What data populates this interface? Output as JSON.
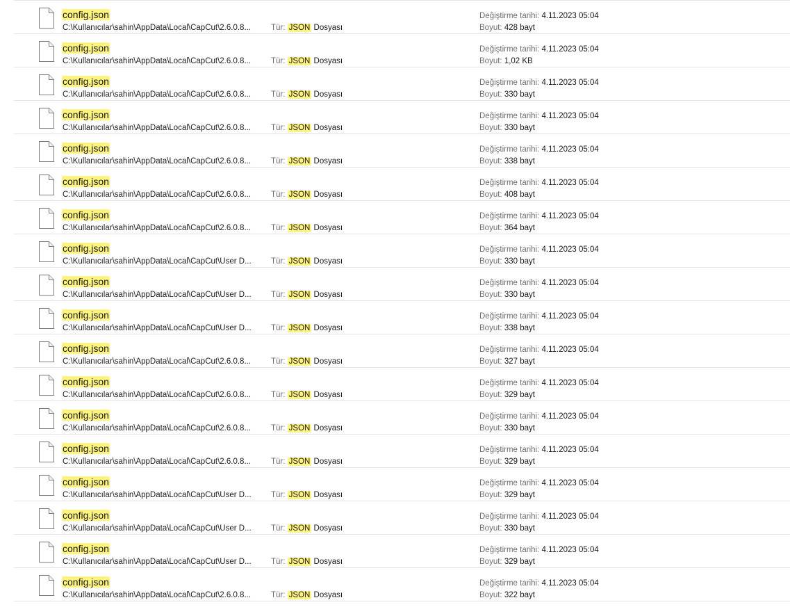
{
  "labels": {
    "type_label": "Tür:",
    "modified_label": "Değiştirme tarihi:",
    "size_label": "Boyut:"
  },
  "icon": "document-file-icon",
  "colors": {
    "highlight": "#fff480",
    "separator": "#e3e3e3",
    "label_gray": "#6d6d6d"
  },
  "results": [
    {
      "name": "config.json",
      "path": "C:\\Kullanıcılar\\sahin\\AppData\\Local\\CapCut\\2.6.0.8...",
      "type_hl": "JSON",
      "type_rest": "Dosyası",
      "modified": "4.11.2023 05:04",
      "size": "428 bayt"
    },
    {
      "name": "config.json",
      "path": "C:\\Kullanıcılar\\sahin\\AppData\\Local\\CapCut\\2.6.0.8...",
      "type_hl": "JSON",
      "type_rest": "Dosyası",
      "modified": "4.11.2023 05:04",
      "size": "1,02 KB"
    },
    {
      "name": "config.json",
      "path": "C:\\Kullanıcılar\\sahin\\AppData\\Local\\CapCut\\2.6.0.8...",
      "type_hl": "JSON",
      "type_rest": "Dosyası",
      "modified": "4.11.2023 05:04",
      "size": "330 bayt"
    },
    {
      "name": "config.json",
      "path": "C:\\Kullanıcılar\\sahin\\AppData\\Local\\CapCut\\2.6.0.8...",
      "type_hl": "JSON",
      "type_rest": "Dosyası",
      "modified": "4.11.2023 05:04",
      "size": "330 bayt"
    },
    {
      "name": "config.json",
      "path": "C:\\Kullanıcılar\\sahin\\AppData\\Local\\CapCut\\2.6.0.8...",
      "type_hl": "JSON",
      "type_rest": "Dosyası",
      "modified": "4.11.2023 05:04",
      "size": "338 bayt"
    },
    {
      "name": "config.json",
      "path": "C:\\Kullanıcılar\\sahin\\AppData\\Local\\CapCut\\2.6.0.8...",
      "type_hl": "JSON",
      "type_rest": "Dosyası",
      "modified": "4.11.2023 05:04",
      "size": "408 bayt"
    },
    {
      "name": "config.json",
      "path": "C:\\Kullanıcılar\\sahin\\AppData\\Local\\CapCut\\2.6.0.8...",
      "type_hl": "JSON",
      "type_rest": "Dosyası",
      "modified": "4.11.2023 05:04",
      "size": "364 bayt"
    },
    {
      "name": "config.json",
      "path": "C:\\Kullanıcılar\\sahin\\AppData\\Local\\CapCut\\User D...",
      "type_hl": "JSON",
      "type_rest": "Dosyası",
      "modified": "4.11.2023 05:04",
      "size": "330 bayt"
    },
    {
      "name": "config.json",
      "path": "C:\\Kullanıcılar\\sahin\\AppData\\Local\\CapCut\\User D...",
      "type_hl": "JSON",
      "type_rest": "Dosyası",
      "modified": "4.11.2023 05:04",
      "size": "330 bayt"
    },
    {
      "name": "config.json",
      "path": "C:\\Kullanıcılar\\sahin\\AppData\\Local\\CapCut\\User D...",
      "type_hl": "JSON",
      "type_rest": "Dosyası",
      "modified": "4.11.2023 05:04",
      "size": "338 bayt"
    },
    {
      "name": "config.json",
      "path": "C:\\Kullanıcılar\\sahin\\AppData\\Local\\CapCut\\2.6.0.8...",
      "type_hl": "JSON",
      "type_rest": "Dosyası",
      "modified": "4.11.2023 05:04",
      "size": "327 bayt"
    },
    {
      "name": "config.json",
      "path": "C:\\Kullanıcılar\\sahin\\AppData\\Local\\CapCut\\2.6.0.8...",
      "type_hl": "JSON",
      "type_rest": "Dosyası",
      "modified": "4.11.2023 05:04",
      "size": "329 bayt"
    },
    {
      "name": "config.json",
      "path": "C:\\Kullanıcılar\\sahin\\AppData\\Local\\CapCut\\2.6.0.8...",
      "type_hl": "JSON",
      "type_rest": "Dosyası",
      "modified": "4.11.2023 05:04",
      "size": "330 bayt"
    },
    {
      "name": "config.json",
      "path": "C:\\Kullanıcılar\\sahin\\AppData\\Local\\CapCut\\2.6.0.8...",
      "type_hl": "JSON",
      "type_rest": "Dosyası",
      "modified": "4.11.2023 05:04",
      "size": "329 bayt"
    },
    {
      "name": "config.json",
      "path": "C:\\Kullanıcılar\\sahin\\AppData\\Local\\CapCut\\User D...",
      "type_hl": "JSON",
      "type_rest": "Dosyası",
      "modified": "4.11.2023 05:04",
      "size": "329 bayt"
    },
    {
      "name": "config.json",
      "path": "C:\\Kullanıcılar\\sahin\\AppData\\Local\\CapCut\\User D...",
      "type_hl": "JSON",
      "type_rest": "Dosyası",
      "modified": "4.11.2023 05:04",
      "size": "330 bayt"
    },
    {
      "name": "config.json",
      "path": "C:\\Kullanıcılar\\sahin\\AppData\\Local\\CapCut\\User D...",
      "type_hl": "JSON",
      "type_rest": "Dosyası",
      "modified": "4.11.2023 05:04",
      "size": "329 bayt"
    },
    {
      "name": "config.json",
      "path": "C:\\Kullanıcılar\\sahin\\AppData\\Local\\CapCut\\2.6.0.8...",
      "type_hl": "JSON",
      "type_rest": "Dosyası",
      "modified": "4.11.2023 05:04",
      "size": "322 bayt"
    }
  ]
}
